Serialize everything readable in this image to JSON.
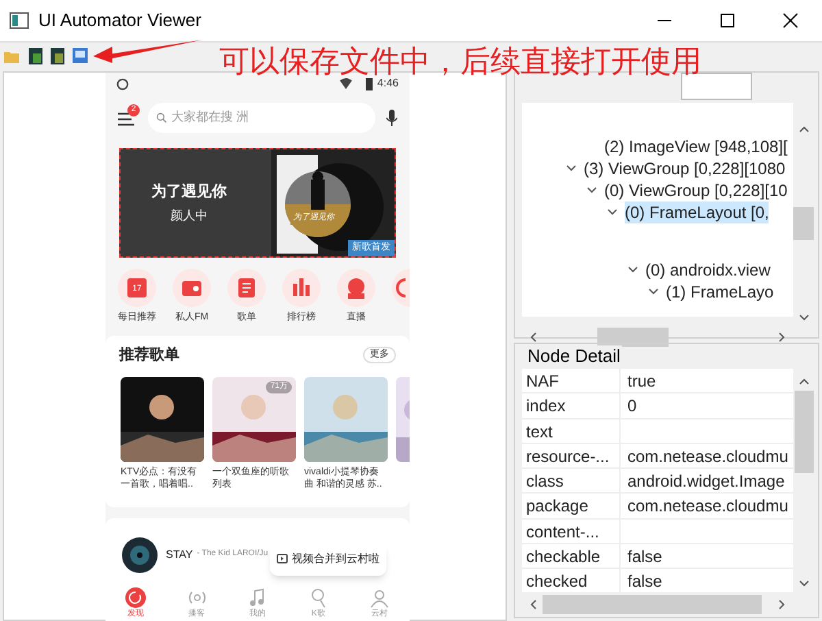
{
  "window": {
    "title": "UI Automator Viewer"
  },
  "annotation": "可以保存文件中，后续直接打开使用",
  "phone": {
    "status_time": "4:46",
    "menu_badge": "2",
    "search": {
      "placeholder": "大家都在搜 洲"
    },
    "banner": {
      "headline": "为了遇见你",
      "subtitle": "颜人中",
      "tag": "新歌首发",
      "disc_title": "为了遇见你"
    },
    "shortcuts": [
      {
        "kind": "calendar",
        "icon_text": "17",
        "label": "每日推荐"
      },
      {
        "kind": "radio",
        "label": "私人FM"
      },
      {
        "kind": "list",
        "label": "歌单"
      },
      {
        "kind": "chart",
        "label": "排行榜"
      },
      {
        "kind": "live",
        "label": "直播"
      },
      {
        "kind": "partial"
      }
    ],
    "section": {
      "title": "推荐歌单",
      "more": "更多"
    },
    "playlists": [
      {
        "caption": "KTV必点：有没有一首歌，唱着唱.."
      },
      {
        "caption": "一个双鱼座的听歌列表",
        "plays": "71万"
      },
      {
        "caption": "vivaldi小提琴协奏曲 和谐的灵感 苏.."
      }
    ],
    "player": {
      "song": "STAY",
      "artist": "- The Kid LAROI/Ju"
    },
    "toast": "视频合并到云村啦",
    "nav": [
      {
        "label": "发现",
        "selected": true
      },
      {
        "label": "播客",
        "selected": false
      },
      {
        "label": "我的",
        "selected": false
      },
      {
        "label": "K歌",
        "selected": false
      },
      {
        "label": "云村",
        "selected": false
      }
    ]
  },
  "tree": [
    {
      "label": "(2) ImageView [948,108][",
      "expanded": false,
      "selected": false
    },
    {
      "label": "(3) ViewGroup [0,228][1080",
      "expanded": true,
      "selected": false,
      "children": [
        {
          "label": "(0) ViewGroup [0,228][10",
          "expanded": true,
          "selected": false,
          "children": [
            {
              "label": "(0) FrameLayout [0,",
              "expanded": true,
              "selected": true,
              "children": [
                {
                  "label": "(0) androidx.view",
                  "expanded": true,
                  "selected": false,
                  "children": [
                    {
                      "label": "(1) FrameLayo",
                      "expanded": true,
                      "selected": false
                    }
                  ]
                }
              ]
            }
          ]
        }
      ]
    }
  ],
  "node_detail": {
    "title": "Node Detail",
    "rows": [
      {
        "name": "NAF",
        "value": "true"
      },
      {
        "name": "index",
        "value": "0"
      },
      {
        "name": "text"
      },
      {
        "name": "resource-...",
        "value": "com.netease.cloudmu"
      },
      {
        "name": "class",
        "value": "android.widget.Image"
      },
      {
        "name": "package",
        "value": "com.netease.cloudmu"
      },
      {
        "name": "content-..."
      },
      {
        "name": "checkable",
        "value": "false"
      },
      {
        "name": "checked",
        "value": "false"
      }
    ]
  }
}
